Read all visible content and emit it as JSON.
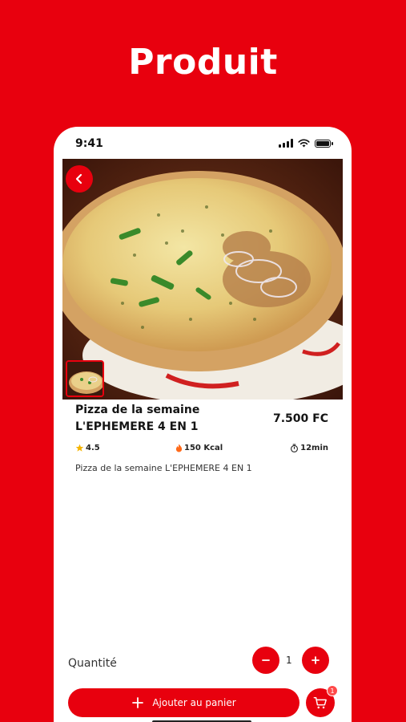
{
  "headline": "Produit",
  "status_bar": {
    "time": "9:41"
  },
  "product": {
    "title": "Pizza de la semaine L'EPHEMERE 4 EN 1",
    "price": "7.500 FC",
    "rating": "4.5",
    "calories": "150 Kcal",
    "duration": "12min",
    "description": "Pizza de la semaine L'EPHEMERE 4 EN 1"
  },
  "quantity": {
    "label": "Quantité",
    "value": "1"
  },
  "actions": {
    "add_to_cart": "Ajouter au panier",
    "cart_count": "1"
  },
  "colors": {
    "accent": "#e8000e"
  },
  "icons": {
    "back": "chevron-left-icon",
    "rating": "star-icon",
    "calories": "flame-icon",
    "duration": "stopwatch-icon",
    "minus": "minus-icon",
    "plus": "plus-icon",
    "cart": "cart-icon"
  }
}
